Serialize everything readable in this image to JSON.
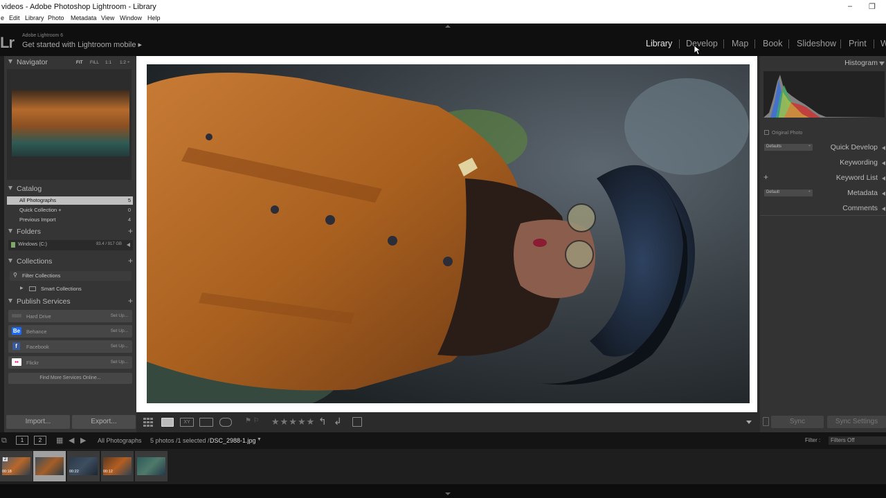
{
  "window": {
    "title": "videos - Adobe Photoshop Lightroom - Library",
    "minimize": "–",
    "restore": "❐"
  },
  "menu": [
    "e",
    "Edit",
    "Library",
    "Photo",
    "Metadata",
    "View",
    "Window",
    "Help"
  ],
  "identity": {
    "logo": "Lr",
    "version": "Adobe Lightroom 6",
    "mobile": "Get started with Lightroom mobile ▸"
  },
  "modules": [
    "Library",
    "Develop",
    "Map",
    "Book",
    "Slideshow",
    "Print",
    "W"
  ],
  "active_module": "Library",
  "navigator": {
    "label": "Navigator",
    "options": [
      "FIT",
      "FILL",
      "1:1",
      "1:2 ÷"
    ]
  },
  "catalog": {
    "label": "Catalog",
    "items": [
      {
        "label": "All Photographs",
        "count": "5"
      },
      {
        "label": "Quick Collection +",
        "count": "0"
      },
      {
        "label": "Previous Import",
        "count": "4"
      }
    ]
  },
  "folders": {
    "label": "Folders",
    "plus": "+",
    "items": [
      {
        "label": "Windows (C:)",
        "size": "83.4 / 917 GB"
      }
    ]
  },
  "collections": {
    "label": "Collections",
    "plus": "+",
    "items": [
      "Filter Collections",
      "Smart Collections"
    ]
  },
  "publish": {
    "label": "Publish Services",
    "plus": "+",
    "items": [
      {
        "label": "Hard Drive",
        "setup": "Set Up..."
      },
      {
        "label": "Behance",
        "setup": "Set Up...",
        "badge": "Be"
      },
      {
        "label": "Facebook",
        "setup": "Set Up...",
        "badge": "f"
      },
      {
        "label": "Flickr",
        "setup": "Set Up...",
        "badge": "••"
      }
    ],
    "find_more": "Find More Services Online..."
  },
  "buttons": {
    "import": "Import...",
    "export": "Export...",
    "sync": "Sync",
    "sync_settings": "Sync Settings"
  },
  "toolbar": {
    "stars": "★★★★★",
    "flags": "⚑ ⚐"
  },
  "right_panel": {
    "histogram": "Histogram",
    "original_photo": "Original Photo",
    "quick_develop": "Quick Develop",
    "defaults_select": "Defaults",
    "keywording": "Keywording",
    "keyword_list": "Keyword List",
    "keyword_plus": "+",
    "metadata": "Metadata",
    "metadata_select": "Default",
    "comments": "Comments"
  },
  "filmbar": {
    "screen1": "1",
    "screen2": "2",
    "source": "All Photographs",
    "count": "5 photos /1 selected /",
    "filename": "DSC_2988-1.jpg",
    "filter_label": "Filter :",
    "filter_value": "Filters Off"
  },
  "filmstrip": [
    {
      "time": "00:18",
      "badge": "2",
      "selected": false,
      "colors": [
        "#4b5a6b",
        "#b9672a",
        "#2d3d4a"
      ]
    },
    {
      "time": "",
      "badge": "",
      "selected": true,
      "colors": [
        "#3b4e5a",
        "#a55e28",
        "#2b3b44"
      ]
    },
    {
      "time": "00:22",
      "badge": "",
      "selected": false,
      "colors": [
        "#2b3a4a",
        "#3d4e60",
        "#1c2630"
      ]
    },
    {
      "time": "00:12",
      "badge": "",
      "selected": false,
      "colors": [
        "#5a3a22",
        "#b45e22",
        "#2e4252"
      ]
    },
    {
      "time": "",
      "badge": "",
      "selected": false,
      "colors": [
        "#2e5a5a",
        "#4f7a6a",
        "#23394a"
      ]
    }
  ],
  "colors": {
    "active_module": "#e6e6e6",
    "selected_row": "#c0c0c0",
    "behance": "#1769ff",
    "facebook": "#3b5998",
    "flickr_pink": "#ff0084",
    "flickr_blue": "#0063dc"
  }
}
